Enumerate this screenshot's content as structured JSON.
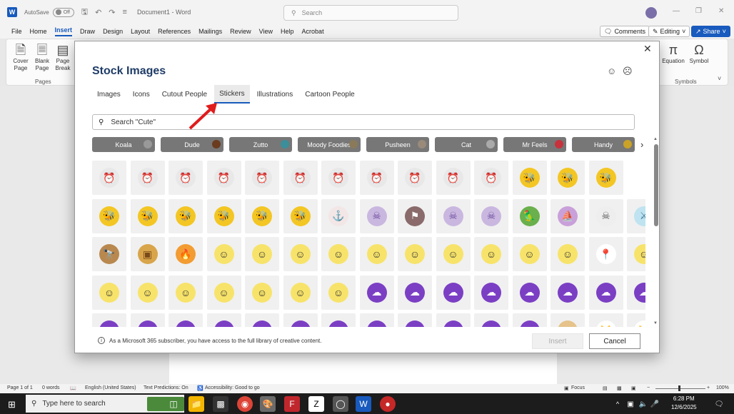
{
  "titlebar": {
    "autosave_label": "AutoSave",
    "autosave_state": "Off",
    "document_title": "Document1",
    "app_name": "Word",
    "search_placeholder": "Search"
  },
  "ribbon_tabs": [
    "File",
    "Home",
    "Insert",
    "Draw",
    "Design",
    "Layout",
    "References",
    "Mailings",
    "Review",
    "View",
    "Help",
    "Acrobat"
  ],
  "active_ribbon_tab": "Insert",
  "ribbon_actions": {
    "comments": "Comments",
    "editing": "Editing",
    "share": "Share"
  },
  "ribbon": {
    "cover_page": "Cover Page",
    "blank_page": "Blank Page",
    "page_break": "Page Break",
    "pages_group": "Pages",
    "equation": "Equation",
    "symbol": "Symbol",
    "symbols_group": "Symbols"
  },
  "dialog": {
    "title": "Stock Images",
    "tabs": [
      "Images",
      "Icons",
      "Cutout People",
      "Stickers",
      "Illustrations",
      "Cartoon People"
    ],
    "selected_tab": "Stickers",
    "search_value": "Search \"Cute\"",
    "chips": [
      "Koala",
      "Dude",
      "Zutto",
      "Moody Foodies",
      "Pusheen",
      "Cat",
      "Mr Feels",
      "Handy"
    ],
    "notice": "As a Microsoft 365 subscriber, you have access to the full library of creative content.",
    "insert_label": "Insert",
    "cancel_label": "Cancel"
  },
  "sticker_rows": [
    [
      "alarm-clock",
      "alarm-clock",
      "alarm-clock",
      "alarm-clock",
      "alarm-clock",
      "alarm-clock",
      "alarm-clock",
      "alarm-clock",
      "alarm-clock",
      "alarm-clock",
      "alarm-clock",
      "bee",
      "bee",
      "bee"
    ],
    [
      "bee",
      "bee",
      "bee",
      "bee",
      "bee",
      "bee",
      "anchor",
      "pirate",
      "pirate-flag",
      "pirate",
      "pirate",
      "parrot",
      "pirate-ship",
      "skull",
      "sword"
    ],
    [
      "telescope",
      "treasure-chest",
      "fire",
      "lemon",
      "lemon",
      "lemon",
      "lemon",
      "lemon",
      "lemon",
      "lemon",
      "lemon",
      "lemon",
      "lemon",
      "pin",
      "lemon"
    ],
    [
      "lemon",
      "lemon",
      "lemon",
      "lemon",
      "lemon",
      "lemon",
      "lemon",
      "purple-blob",
      "purple-blob",
      "purple-blob",
      "purple-blob",
      "purple-blob",
      "purple-blob",
      "purple-blob",
      "purple-blob"
    ],
    [
      "purple-blob",
      "purple-blob",
      "purple-blob",
      "purple-blob",
      "purple-blob",
      "purple-blob",
      "purple-blob",
      "purple-blob",
      "purple-blob",
      "purple-blob",
      "purple-blob",
      "purple-blob",
      "toast",
      "cat",
      "cat"
    ]
  ],
  "colors": {
    "word_blue": "#185abd",
    "chip_gray": "#777777",
    "accent_red": "#e01c1c"
  },
  "statusbar": {
    "page": "Page 1 of 1",
    "words": "0 words",
    "language": "English (United States)",
    "predictions": "Text Predictions: On",
    "accessibility": "Accessibility: Good to go",
    "focus": "Focus",
    "zoom": "100%"
  },
  "taskbar": {
    "search_placeholder": "Type here to search",
    "time": "6:28 PM",
    "date": "12/6/2025"
  }
}
